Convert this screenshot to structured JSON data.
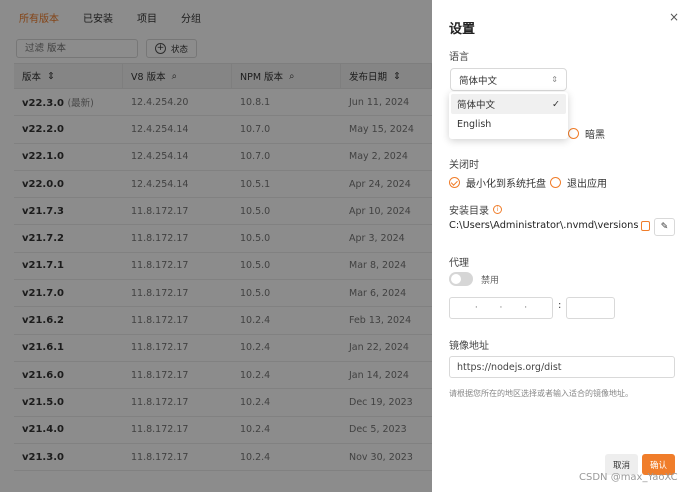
{
  "tabs": [
    "所有版本",
    "已安装",
    "项目",
    "分组"
  ],
  "filter": {
    "placeholder": "过滤 版本",
    "status_label": "状态"
  },
  "table": {
    "headers": [
      "版本",
      "V8 版本",
      "NPM 版本",
      "发布日期"
    ],
    "rows": [
      {
        "version": "v22.3.0",
        "tag": "(最新)",
        "v8": "12.4.254.20",
        "npm": "10.8.1",
        "date": "Jun 11, 2024"
      },
      {
        "version": "v22.2.0",
        "tag": "",
        "v8": "12.4.254.14",
        "npm": "10.7.0",
        "date": "May 15, 2024"
      },
      {
        "version": "v22.1.0",
        "tag": "",
        "v8": "12.4.254.14",
        "npm": "10.7.0",
        "date": "May 2, 2024"
      },
      {
        "version": "v22.0.0",
        "tag": "",
        "v8": "12.4.254.14",
        "npm": "10.5.1",
        "date": "Apr 24, 2024"
      },
      {
        "version": "v21.7.3",
        "tag": "",
        "v8": "11.8.172.17",
        "npm": "10.5.0",
        "date": "Apr 10, 2024"
      },
      {
        "version": "v21.7.2",
        "tag": "",
        "v8": "11.8.172.17",
        "npm": "10.5.0",
        "date": "Apr 3, 2024"
      },
      {
        "version": "v21.7.1",
        "tag": "",
        "v8": "11.8.172.17",
        "npm": "10.5.0",
        "date": "Mar 8, 2024"
      },
      {
        "version": "v21.7.0",
        "tag": "",
        "v8": "11.8.172.17",
        "npm": "10.5.0",
        "date": "Mar 6, 2024"
      },
      {
        "version": "v21.6.2",
        "tag": "",
        "v8": "11.8.172.17",
        "npm": "10.2.4",
        "date": "Feb 13, 2024"
      },
      {
        "version": "v21.6.1",
        "tag": "",
        "v8": "11.8.172.17",
        "npm": "10.2.4",
        "date": "Jan 22, 2024"
      },
      {
        "version": "v21.6.0",
        "tag": "",
        "v8": "11.8.172.17",
        "npm": "10.2.4",
        "date": "Jan 14, 2024"
      },
      {
        "version": "v21.5.0",
        "tag": "",
        "v8": "11.8.172.17",
        "npm": "10.2.4",
        "date": "Dec 19, 2023"
      },
      {
        "version": "v21.4.0",
        "tag": "",
        "v8": "11.8.172.17",
        "npm": "10.2.4",
        "date": "Dec 5, 2023"
      },
      {
        "version": "v21.3.0",
        "tag": "",
        "v8": "11.8.172.17",
        "npm": "10.2.4",
        "date": "Nov 30, 2023"
      }
    ]
  },
  "settings": {
    "title": "设置",
    "close_icon": "×",
    "language_label": "语言",
    "language_value": "简体中文",
    "language_options": [
      {
        "label": "简体中文",
        "selected": true,
        "check": "✓"
      },
      {
        "label": "English",
        "selected": false,
        "check": ""
      }
    ],
    "theme_dark_label": "暗黑",
    "close_label": "关闭时",
    "close_options": [
      "最小化到系统托盘",
      "退出应用"
    ],
    "install_dir_label": "安装目录",
    "install_dir": "C:\\Users\\Administrator\\.nvmd\\versions",
    "proxy_label": "代理",
    "proxy_toggle_label": "禁用",
    "ip_dots": [
      "·",
      "·",
      "·"
    ],
    "port_separator": ":",
    "mirror_label": "镜像地址",
    "mirror_value": "https://nodejs.org/dist",
    "mirror_hint": "请根据您所在的地区选择或者输入适合的镜像地址。",
    "cancel_label": "取消",
    "ok_label": "确认"
  },
  "watermark": "CSDN @max_YaoXC",
  "colors": {
    "accent": "#f07d2a",
    "highlight_box": "#e45353"
  }
}
